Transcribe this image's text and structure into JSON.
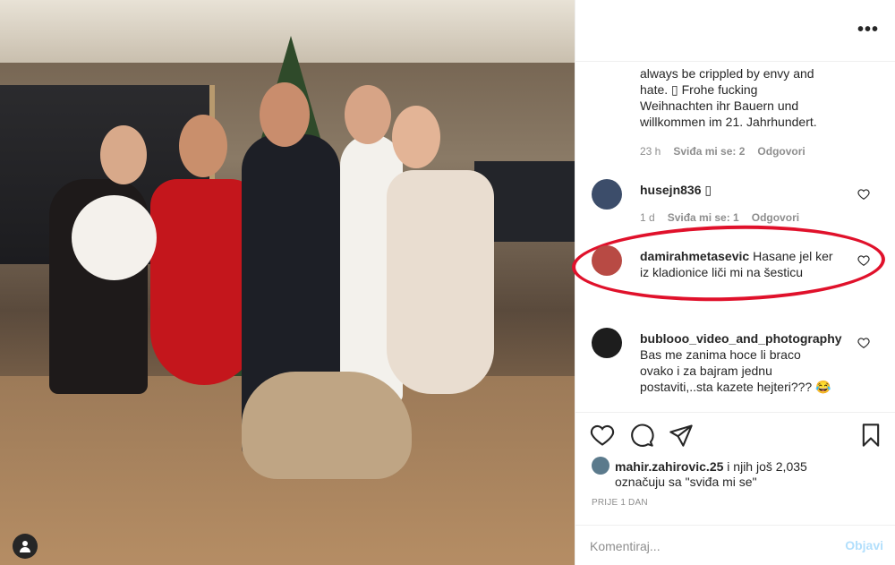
{
  "header": {
    "more_icon": "more-horizontal-icon"
  },
  "comments": [
    {
      "text_lines": [
        "always be crippled by envy and",
        "hate. ▯ Frohe fucking",
        "Weihnachten ihr Bauern und",
        "willkommen im 21. Jahrhundert."
      ],
      "time": "23 h",
      "likes": "Sviđa mi se: 2",
      "reply": "Odgovori"
    },
    {
      "username": "husejn836",
      "text": "▯",
      "time": "1 d",
      "likes": "Sviđa mi se: 1",
      "reply": "Odgovori"
    },
    {
      "username": "damirahmetasevic",
      "text": "Hasane jel ker",
      "text_line2": "iz kladionice liči mi na šesticu"
    },
    {
      "username": "bublooo_video_and_photography",
      "text_lines": [
        "Bas me zanima hoce li braco",
        "ovako i za bajram jednu",
        "postaviti,..sta kazete hejteri??? 😂"
      ]
    }
  ],
  "likes": {
    "user": "mahir.zahirovic.25",
    "rest": " i njih još 2,035",
    "line2": "označuju sa \"sviđa mi se\""
  },
  "date": "PRIJE 1 DAN",
  "comment_input": {
    "placeholder": "Komentiraj...",
    "post_label": "Objavi"
  },
  "colors": {
    "highlight": "#e0112b",
    "muted": "#8e8e8e",
    "post_disabled": "#b2dffc"
  }
}
